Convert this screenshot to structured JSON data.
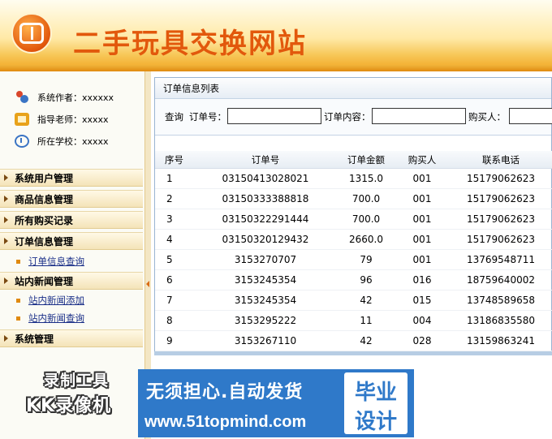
{
  "header": {
    "title": "二手玩具交换网站"
  },
  "sidebar": {
    "info": [
      {
        "label": "系统作者：xxxxxx",
        "icon": "people-icon"
      },
      {
        "label": "指导老师：xxxxx",
        "icon": "teacher-icon"
      },
      {
        "label": "所在学校：xxxxx",
        "icon": "school-icon"
      }
    ],
    "menus": [
      {
        "label": "系统用户管理"
      },
      {
        "label": "商品信息管理"
      },
      {
        "label": "所有购买记录"
      },
      {
        "label": "订单信息管理"
      },
      {
        "label": "订单信息查询"
      },
      {
        "label": "站内新闻管理"
      },
      {
        "label": "站内新闻添加"
      },
      {
        "label": "站内新闻查询"
      },
      {
        "label": "系统管理"
      }
    ]
  },
  "main": {
    "panel_title": "订单信息列表",
    "search": {
      "query_label": "查询",
      "order_no_label": "订单号：",
      "order_content_label": "订单内容：",
      "buyer_label": "购买人：",
      "order_no_value": "",
      "order_content_value": "",
      "buyer_value": ""
    },
    "columns": [
      "序号",
      "订单号",
      "订单金额",
      "购买人",
      "联系电话"
    ],
    "rows": [
      [
        "1",
        "03150413028021",
        "1315.0",
        "001",
        "15179062623"
      ],
      [
        "2",
        "03150333388818",
        "700.0",
        "001",
        "15179062623"
      ],
      [
        "3",
        "03150322291444",
        "700.0",
        "001",
        "15179062623"
      ],
      [
        "4",
        "03150320129432",
        "2660.0",
        "001",
        "15179062623"
      ],
      [
        "5",
        "3153270707",
        "79",
        "001",
        "13769548711"
      ],
      [
        "6",
        "3153245354",
        "96",
        "016",
        "18759640002"
      ],
      [
        "7",
        "3153245354",
        "42",
        "015",
        "13748589658"
      ],
      [
        "8",
        "3153295222",
        "11",
        "004",
        "13186835580"
      ],
      [
        "9",
        "3153267110",
        "42",
        "028",
        "13159863241"
      ]
    ]
  },
  "watermarks": {
    "recorder_line1": "录制工具",
    "recorder_line2": "KK录像机",
    "banner_line1": "无须担心.自动发货",
    "banner_line2": "www.51topmind.com",
    "badge_line1": "毕业",
    "badge_line2": "设计"
  },
  "colors": {
    "title": "#e2580c",
    "link": "#1a2f88",
    "banner": "#2f79c9"
  }
}
